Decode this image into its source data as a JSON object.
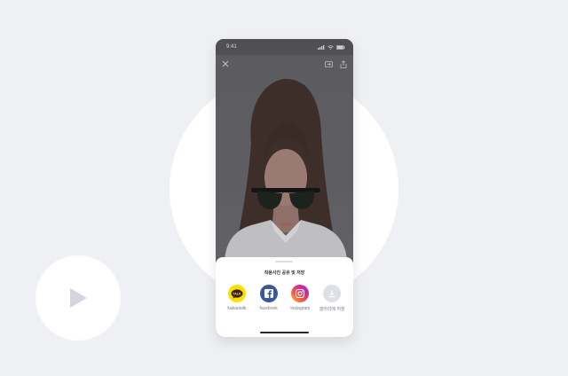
{
  "status_bar": {
    "time": "9:41"
  },
  "share_sheet": {
    "title": "착용사진 공유 및 저장",
    "options": [
      {
        "label": "kakaotalk",
        "icon": "kakaotalk-icon",
        "color": "#fae100"
      },
      {
        "label": "facebook",
        "icon": "facebook-icon",
        "color": "#3b5998"
      },
      {
        "label": "instagram",
        "icon": "instagram-icon",
        "color": "#d6249f"
      },
      {
        "label": "갤러리에 저장",
        "icon": "download-icon",
        "color": "#dfe0e7"
      }
    ]
  },
  "kakao_badge": "TALK",
  "colors": {
    "background": "#eff0f3",
    "overlay": "#58585c"
  }
}
